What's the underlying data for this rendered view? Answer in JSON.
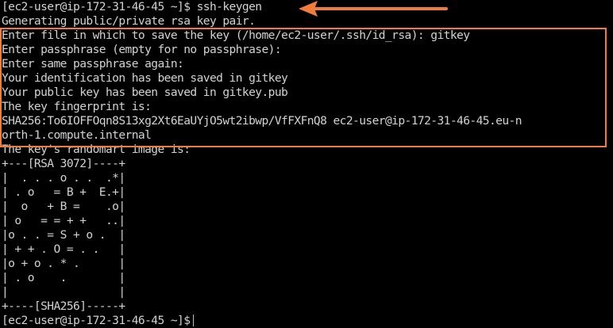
{
  "terminal": {
    "lines": [
      "[ec2-user@ip-172-31-46-45 ~]$ ssh-keygen",
      "Generating public/private rsa key pair.",
      "Enter file in which to save the key (/home/ec2-user/.ssh/id_rsa): gitkey",
      "Enter passphrase (empty for no passphrase):",
      "Enter same passphrase again:",
      "Your identification has been saved in gitkey",
      "Your public key has been saved in gitkey.pub",
      "The key fingerprint is:",
      "SHA256:To6IOFFOqn8S13xg2Xt6EaUYjO5wt2ibwp/VfFXFnQ8 ec2-user@ip-172-31-46-45.eu-n",
      "orth-1.compute.internal",
      "The key's randomart image is:",
      "+---[RSA 3072]----+",
      "|  . . . o . .  .*|",
      "| . o   = B +  E.+|",
      "|  o   + B =    .o|",
      "| o   = = + +   ..|",
      "|o . . = S + o .  |",
      "| + + . O = . .   |",
      "|o + o . * .      |",
      "| . o    .        |",
      "|                 |",
      "+----[SHA256]-----+"
    ],
    "prompt": "[ec2-user@ip-172-31-46-45 ~]$"
  },
  "colors": {
    "background": "#000000",
    "text": "#d2d2d2",
    "annotation": "#f07c3a"
  },
  "icons": {
    "arrow": "left-arrow-icon"
  }
}
